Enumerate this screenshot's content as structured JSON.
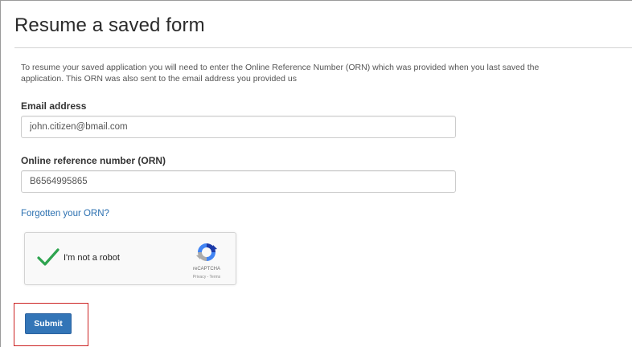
{
  "page": {
    "title": "Resume a saved form",
    "intro_line1": "To resume your saved application you will need to enter the Online Reference Number (ORN) which was provided when you last saved the",
    "intro_line2": "application. This ORN was also sent to the email address you provided us"
  },
  "form": {
    "email": {
      "label": "Email address",
      "value": "john.citizen@bmail.com"
    },
    "orn": {
      "label": "Online reference number (ORN)",
      "value": "B6564995865"
    },
    "forgot_link": "Forgotten your ORN?",
    "submit_label": "Submit"
  },
  "recaptcha": {
    "label": "I'm not a robot",
    "brand": "reCAPTCHA",
    "terms": "Privacy - Terms",
    "checked": true,
    "check_icon": "checkmark-icon",
    "logo_icon": "recaptcha-logo-icon"
  },
  "colors": {
    "link": "#2a6fb0",
    "button": "#3375b7",
    "highlight": "#cc2222",
    "check": "#2ea44f"
  }
}
